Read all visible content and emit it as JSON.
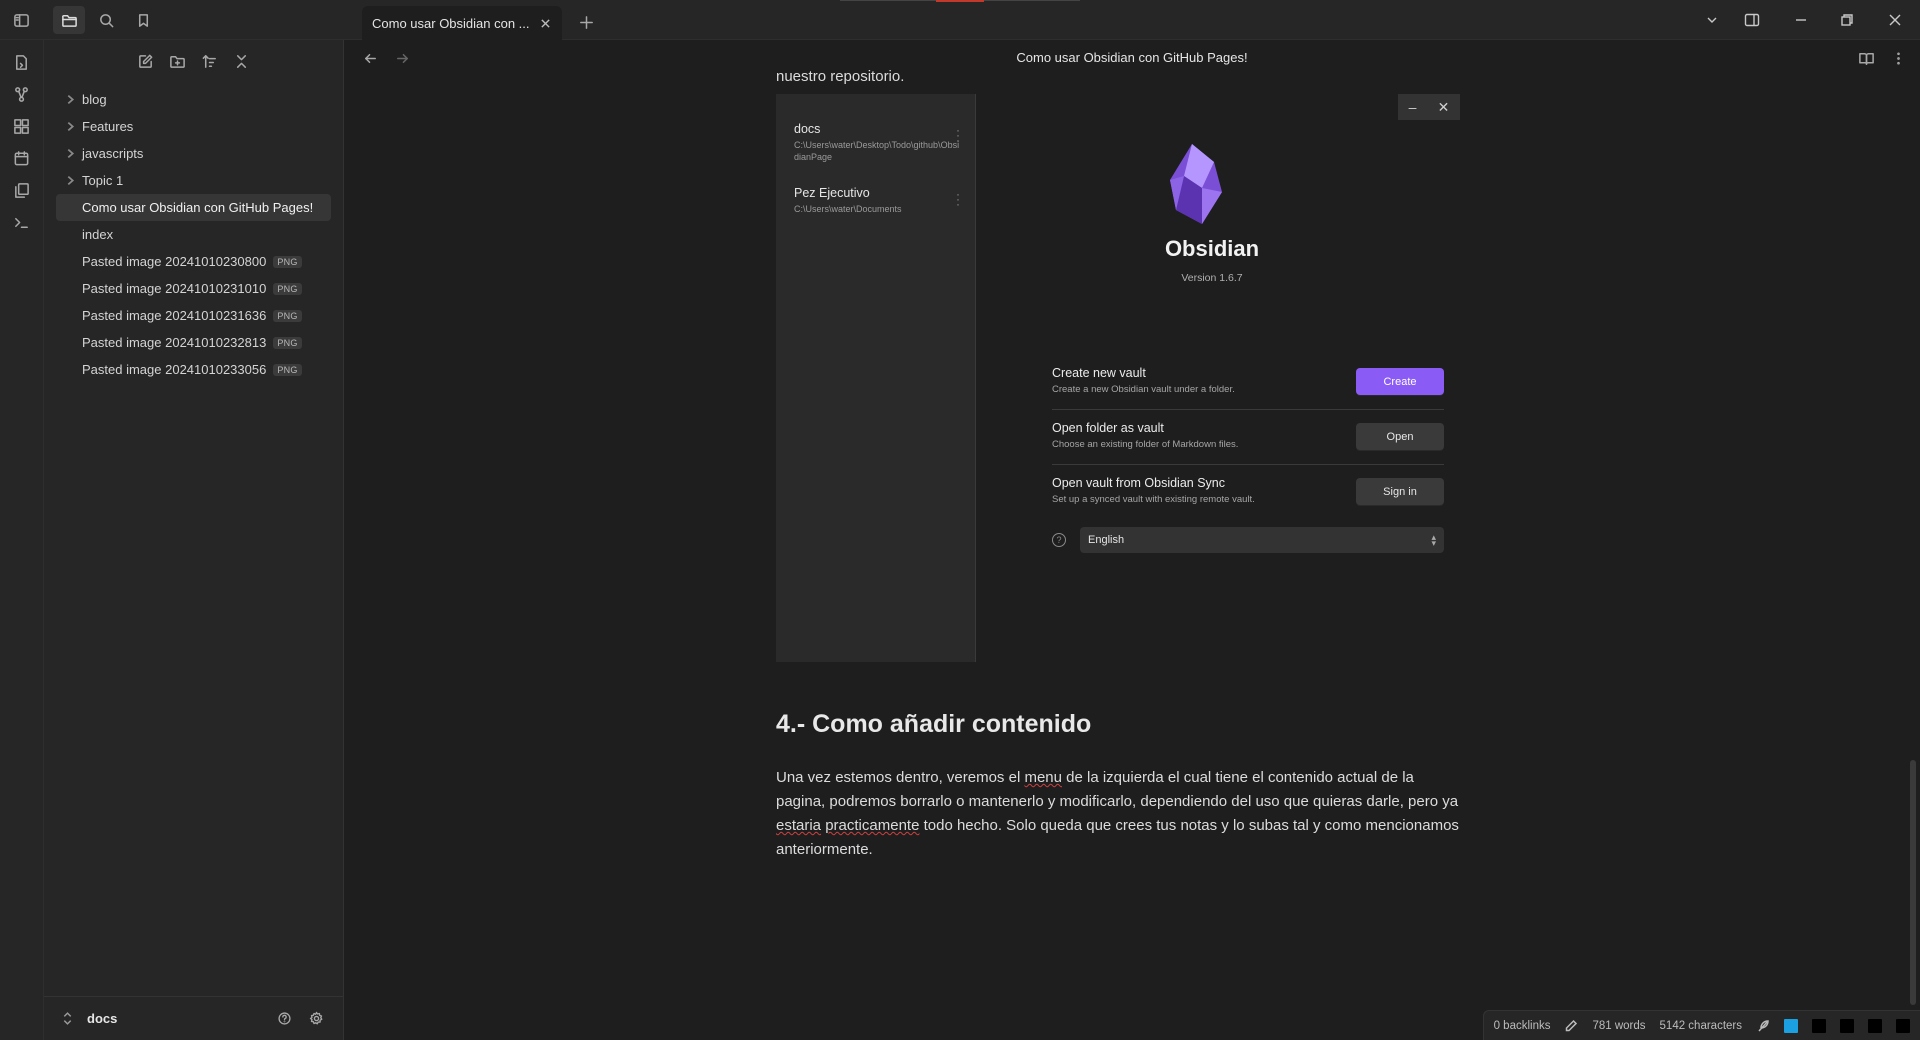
{
  "tab": {
    "title": "Como usar Obsidian con ..."
  },
  "sidebar": {
    "items": [
      {
        "label": "blog",
        "type": "folder"
      },
      {
        "label": "Features",
        "type": "folder"
      },
      {
        "label": "javascripts",
        "type": "folder"
      },
      {
        "label": "Topic 1",
        "type": "folder"
      },
      {
        "label": "Como usar Obsidian con GitHub Pages!",
        "type": "file",
        "active": true
      },
      {
        "label": "index",
        "type": "file"
      },
      {
        "label": "Pasted image 20241010230800",
        "type": "file",
        "badge": "PNG"
      },
      {
        "label": "Pasted image 20241010231010",
        "type": "file",
        "badge": "PNG"
      },
      {
        "label": "Pasted image 20241010231636",
        "type": "file",
        "badge": "PNG"
      },
      {
        "label": "Pasted image 20241010232813",
        "type": "file",
        "badge": "PNG"
      },
      {
        "label": "Pasted image 20241010233056",
        "type": "file",
        "badge": "PNG"
      }
    ],
    "vault_name": "docs"
  },
  "view": {
    "title": "Como usar Obsidian con GitHub Pages!"
  },
  "content": {
    "intro": "nuestro repositorio.",
    "heading": "4.- Como añadir contenido",
    "para_1": "Una vez estemos dentro, veremos el ",
    "para_menu": "menu",
    "para_2": " de la izquierda el cual tiene el contenido actual de la pagina, podremos borrarlo o mantenerlo y modificarlo, dependiendo del uso que quieras darle, pero ya ",
    "para_estaria": "estaria",
    "para_space": " ",
    "para_practicamente": "practicamente",
    "para_3": " todo hecho. Solo queda que crees tus notas y lo subas tal y como mencionamos anteriormente."
  },
  "embedded": {
    "vaults": [
      {
        "name": "docs",
        "path_line1": "C:\\Users\\water\\Desktop\\Todo\\github\\Obsi",
        "path_line2": "dianPage"
      },
      {
        "name": "Pez Ejecutivo",
        "path_line1": "C:\\Users\\water\\Documents",
        "path_line2": ""
      }
    ],
    "app_name": "Obsidian",
    "version": "Version 1.6.7",
    "options": [
      {
        "title": "Create new vault",
        "desc": "Create a new Obsidian vault under a folder.",
        "button": "Create"
      },
      {
        "title": "Open folder as vault",
        "desc": "Choose an existing folder of Markdown files.",
        "button": "Open"
      },
      {
        "title": "Open vault from Obsidian Sync",
        "desc": "Set up a synced vault with existing remote vault.",
        "button": "Sign in"
      }
    ],
    "language": "English",
    "accent": "#8a5cf5"
  },
  "status": {
    "backlinks": "0 backlinks",
    "words": "781 words",
    "characters": "5142 characters",
    "swatches": [
      "#1ba1e2",
      "#000000",
      "#000000",
      "#000000",
      "#000000"
    ]
  }
}
